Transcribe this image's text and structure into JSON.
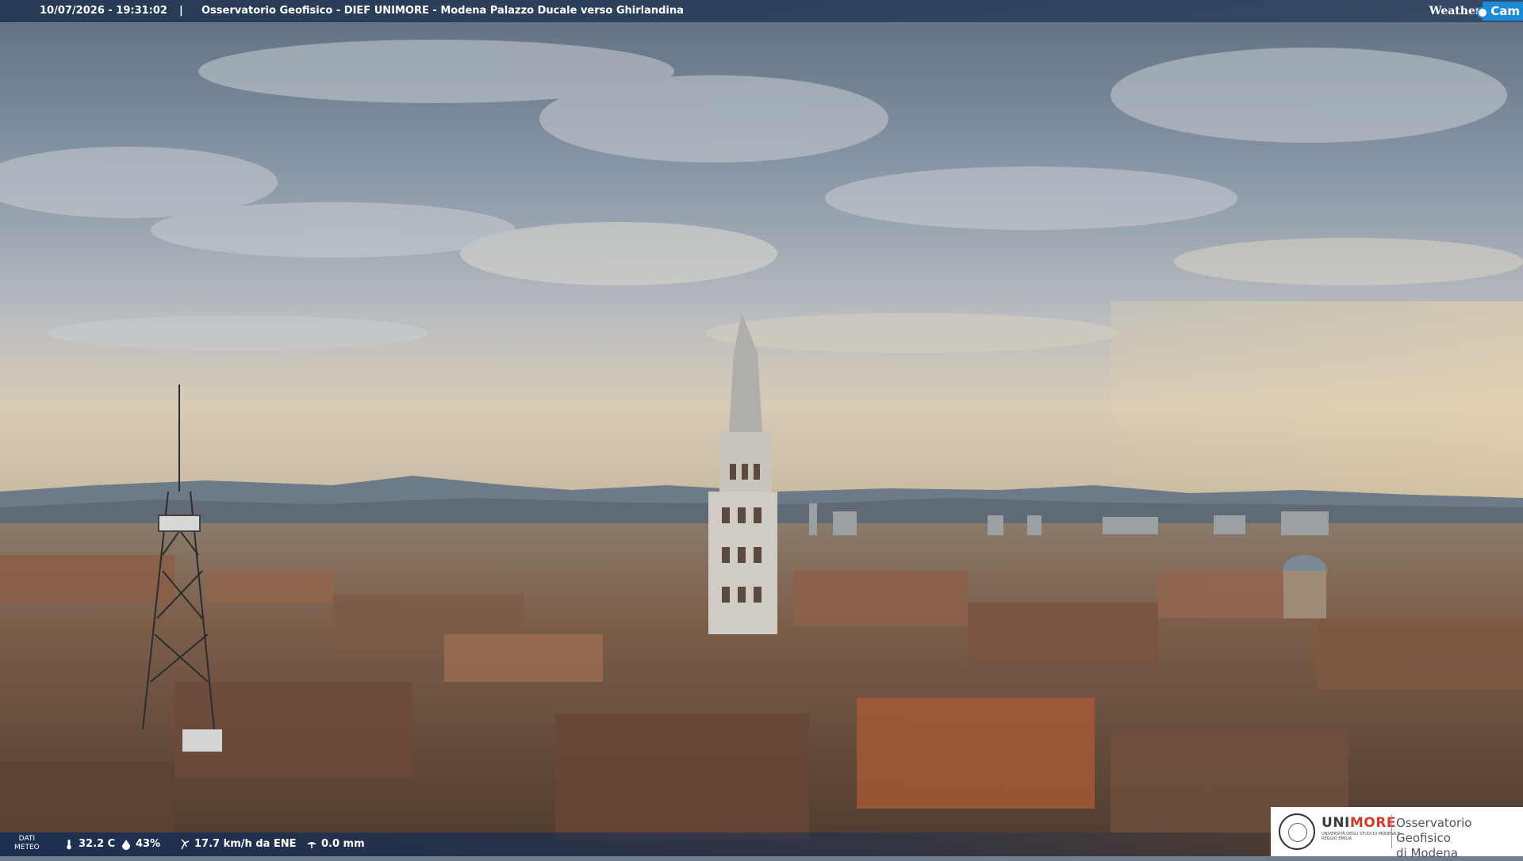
{
  "header": {
    "datetime": "10/07/2026 - 19:31:02",
    "separator": "|",
    "title": "Osservatorio Geofisico - DIEF UNIMORE - Modena Palazzo Ducale verso Ghirlandina",
    "brand_weather": "Weather",
    "brand_cam": "Cam"
  },
  "weather": {
    "section_label_1": "DATI",
    "section_label_2": "METEO",
    "temperature": "32.2 C",
    "humidity": "43%",
    "wind": "17.7 km/h da ENE",
    "rain": "0.0 mm",
    "icons": [
      "thermometer-icon",
      "humidity-drop-icon",
      "wind-icon",
      "rain-gauge-icon"
    ]
  },
  "logo": {
    "uni_prefix": "UNI",
    "uni_suffix": "MORE",
    "uni_subtitle": "UNIVERSITÀ DEGLI STUDI DI MODENA E REGGIO EMILIA",
    "observatory_line1": "Osservatorio Geofisico",
    "observatory_line2": "di Modena"
  },
  "colors": {
    "sky_top": "#6d7d8e",
    "sky_horizon": "#d9cbb2",
    "roofs": "#7a5a48",
    "bar_blue": "#1c3056",
    "brand_blue": "#1d8ad8",
    "unimore_red": "#d23a2a"
  }
}
